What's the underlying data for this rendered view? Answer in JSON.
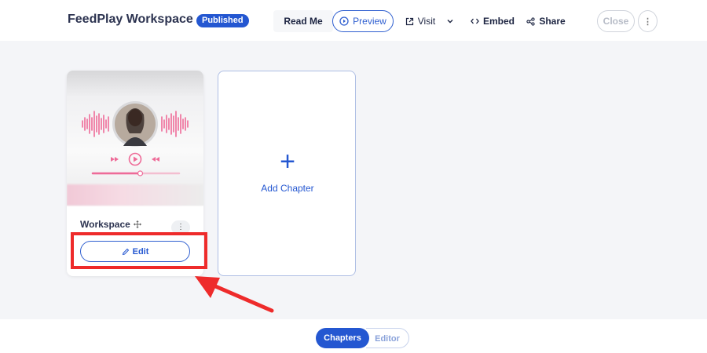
{
  "header": {
    "title": "FeedPlay Workspace",
    "status_badge": "Published",
    "read_me": "Read Me",
    "preview": "Preview",
    "visit": "Visit",
    "embed": "Embed",
    "share": "Share",
    "close": "Close"
  },
  "chapters": [
    {
      "title": "Workspace",
      "edit_label": "Edit",
      "player_progress": 0.55
    }
  ],
  "add_chapter": {
    "label": "Add Chapter"
  },
  "bottom_tabs": {
    "chapters": "Chapters",
    "editor": "Editor"
  },
  "colors": {
    "accent": "#2457d1",
    "annotation_red": "#ee2b2b",
    "waveform_pink": "#ee6b98"
  }
}
